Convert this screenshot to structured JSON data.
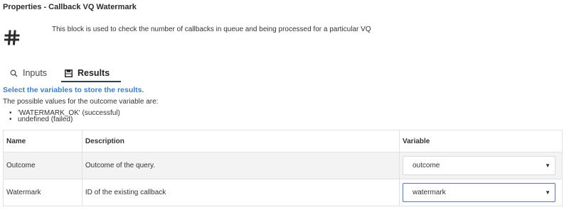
{
  "panel": {
    "title": "Properties - Callback VQ Watermark",
    "description": "This block is used to check the number of callbacks in queue and being processed for a particular VQ"
  },
  "tabs": [
    {
      "label": "Inputs",
      "icon": "search-icon",
      "active": false
    },
    {
      "label": "Results",
      "icon": "save-icon",
      "active": true
    }
  ],
  "results": {
    "instruction": "Select the variables to store the results.",
    "possible_values_intro": "The possible values for the outcome variable are:",
    "possible_values": [
      "'WATERMARK_OK' (successful)",
      "undefined (failed)"
    ],
    "table": {
      "headers": [
        "Name",
        "Description",
        "Variable"
      ],
      "rows": [
        {
          "name": "Outcome",
          "description": "Outcome of the query.",
          "variable": "outcome"
        },
        {
          "name": "Watermark",
          "description": "ID of the existing callback",
          "variable": "watermark"
        }
      ]
    }
  },
  "colors": {
    "accent": "#3e7fc1",
    "tab_underline": "#2f3d4d",
    "focus_border": "#4c7bc4"
  }
}
